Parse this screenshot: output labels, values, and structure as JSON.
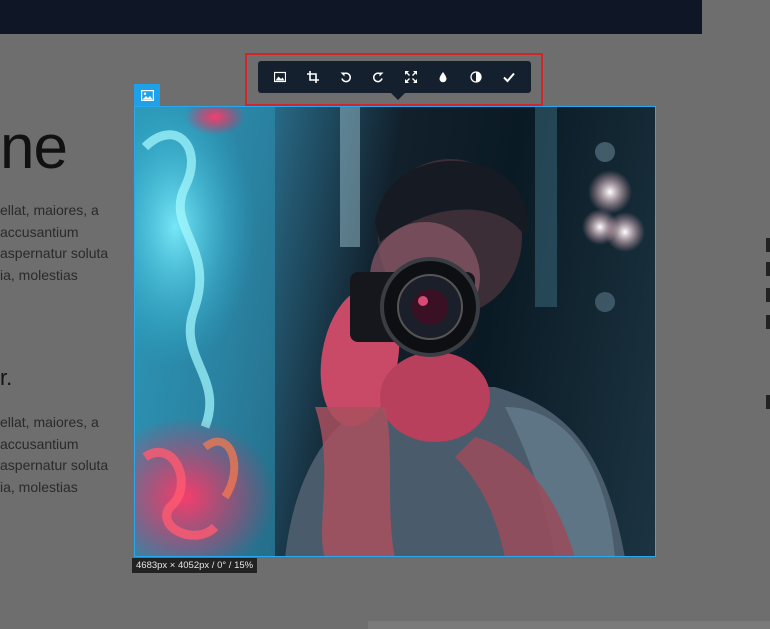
{
  "page": {
    "heading_big": "ne",
    "paragraph1": [
      "ellat, maiores, a",
      "accusantium",
      "aspernatur soluta",
      "ia, molestias"
    ],
    "heading_small": "r.",
    "paragraph2": [
      "ellat, maiores, a",
      "accusantium",
      "aspernatur soluta",
      "ia, molestias"
    ]
  },
  "toolbar": {
    "buttons": [
      {
        "name": "replace-image-icon"
      },
      {
        "name": "crop-icon"
      },
      {
        "name": "rotate-left-icon"
      },
      {
        "name": "rotate-right-icon"
      },
      {
        "name": "fullscreen-icon"
      },
      {
        "name": "blur-drop-icon"
      },
      {
        "name": "contrast-icon"
      },
      {
        "name": "checkmark-icon"
      }
    ]
  },
  "image": {
    "badge_icon": "image-icon",
    "info": "4683px × 4052px / 0° / 15%"
  },
  "colors": {
    "accent": "#1fa1ea",
    "highlight": "#d0262a",
    "toolbar_bg": "#15202f"
  }
}
